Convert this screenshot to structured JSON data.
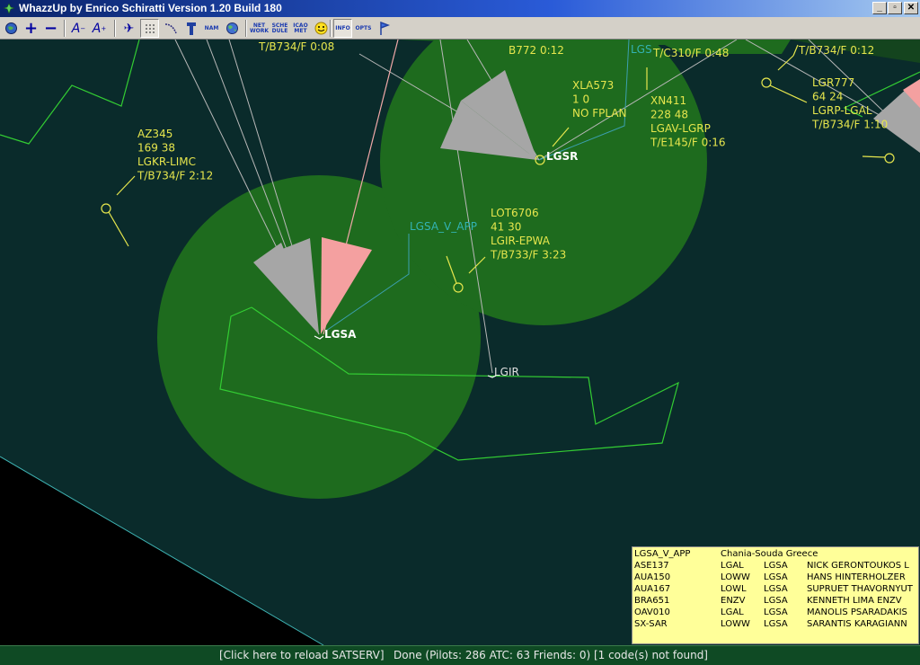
{
  "window": {
    "title": "WhazzUp by Enrico Schiratti Version 1.20 Build 180",
    "minimize": "_",
    "maximize": "▫",
    "close": "✕"
  },
  "toolbar": {
    "net_work": [
      "NET",
      "WORK"
    ],
    "sche_dule": [
      "SCHE",
      "DULE"
    ],
    "icao_met": [
      "ICAO",
      "MET"
    ],
    "nam": "NAM",
    "info": "INFO",
    "opts": "OPTS"
  },
  "map": {
    "airports": [
      {
        "code": "LGSA"
      },
      {
        "code": "LGSR"
      },
      {
        "code": "LGIR"
      }
    ],
    "atc_label": "LGSA_V_APP",
    "partial_label": "LGS",
    "flights": [
      {
        "lines": [
          "T/B734/F 0:08"
        ]
      },
      {
        "lines": [
          "B772 0:12"
        ]
      },
      {
        "lines": [
          "T/C310/F 0:48"
        ]
      },
      {
        "lines": [
          "T/B734/F 0:12"
        ]
      },
      {
        "lines": [
          "AZ345",
          "169 38",
          "LGKR-LIMC",
          "T/B734/F 2:12"
        ]
      },
      {
        "lines": [
          "XLA573",
          "1 0",
          "NO FPLAN"
        ]
      },
      {
        "lines": [
          "XN411",
          "228 48",
          "LGAV-LGRP",
          "T/E145/F 0:16"
        ]
      },
      {
        "lines": [
          "LGR777",
          "64 24",
          "LGRP-LGAL",
          "T/B734/F 1:10"
        ]
      },
      {
        "lines": [
          "LOT6706",
          "41 30",
          "LGIR-EPWA",
          "T/B733/F 3:23"
        ]
      }
    ]
  },
  "info_panel": {
    "header": {
      "callsign": "LGSA_V_APP",
      "location": "Chania-Souda Greece"
    },
    "rows": [
      {
        "callsign": "ASE137",
        "from": "LGAL",
        "to": "LGSA",
        "name": "NICK GERONTOUKOS L"
      },
      {
        "callsign": "AUA150",
        "from": "LOWW",
        "to": "LGSA",
        "name": "HANS HINTERHOLZER"
      },
      {
        "callsign": "AUA167",
        "from": "LOWL",
        "to": "LGSA",
        "name": "SUPRUET THAVORNYUT"
      },
      {
        "callsign": "BRA651",
        "from": "ENZV",
        "to": "LGSA",
        "name": "KENNETH LIMA ENZV"
      },
      {
        "callsign": "OAV010",
        "from": "LGAL",
        "to": "LGSA",
        "name": "MANOLIS PSARADAKIS"
      },
      {
        "callsign": "SX-SAR",
        "from": "LOWW",
        "to": "LGSA",
        "name": "SARANTIS KARAGIANN"
      }
    ]
  },
  "status": {
    "reload": "[Click here to reload SATSERV]",
    "text": "Done (Pilots: 286  ATC: 63  Friends: 0) [1 code(s) not found]"
  },
  "colors": {
    "sea": "#0a2b2b",
    "land": "#000000",
    "atc_zone": "#1e6b1e",
    "coast": "#33cc33",
    "flight_label": "#e6e64d",
    "atc_label": "#33b3b3",
    "sector_gray": "#a6a6a6",
    "sector_pink": "#f4a0a0",
    "info_bg": "#ffff99"
  }
}
